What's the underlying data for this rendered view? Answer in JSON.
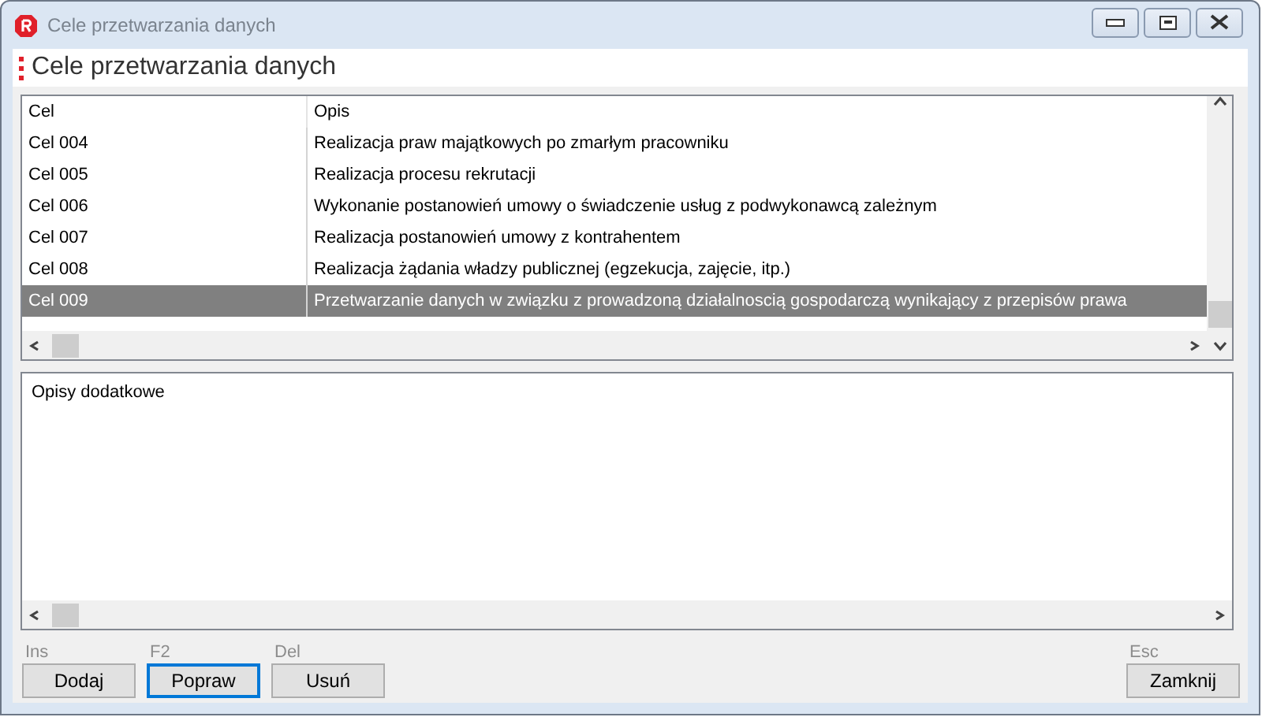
{
  "window": {
    "title": "Cele przetwarzania danych"
  },
  "header": {
    "title": "Cele przetwarzania danych"
  },
  "table": {
    "columns": [
      "Cel",
      "Opis"
    ],
    "rows": [
      {
        "cells": [
          "Cel 004",
          "Realizacja praw majątkowych po zmarłym pracowniku"
        ],
        "selected": false
      },
      {
        "cells": [
          "Cel 005",
          "Realizacja procesu rekrutacji"
        ],
        "selected": false
      },
      {
        "cells": [
          "Cel 006",
          "Wykonanie postanowień umowy o świadczenie usług z podwykonawcą zależnym"
        ],
        "selected": false
      },
      {
        "cells": [
          "Cel 007",
          "Realizacja postanowień umowy z kontrahentem"
        ],
        "selected": false
      },
      {
        "cells": [
          "Cel 008",
          "Realizacja żądania władzy publicznej (egzekucja, zajęcie, itp.)"
        ],
        "selected": false
      },
      {
        "cells": [
          "Cel 009",
          "Przetwarzanie danych w związku z prowadzoną działalnoscią gospodarczą wynikający z przepisów prawa"
        ],
        "selected": true
      }
    ]
  },
  "details": {
    "label": "Opisy dodatkowe"
  },
  "buttons": [
    {
      "shortcut": "Ins",
      "label": "Dodaj",
      "focused": false
    },
    {
      "shortcut": "F2",
      "label": "Popraw",
      "focused": true
    },
    {
      "shortcut": "Del",
      "label": "Usuń",
      "focused": false
    }
  ],
  "close_button": {
    "shortcut": "Esc",
    "label": "Zamknij",
    "focused": false
  }
}
